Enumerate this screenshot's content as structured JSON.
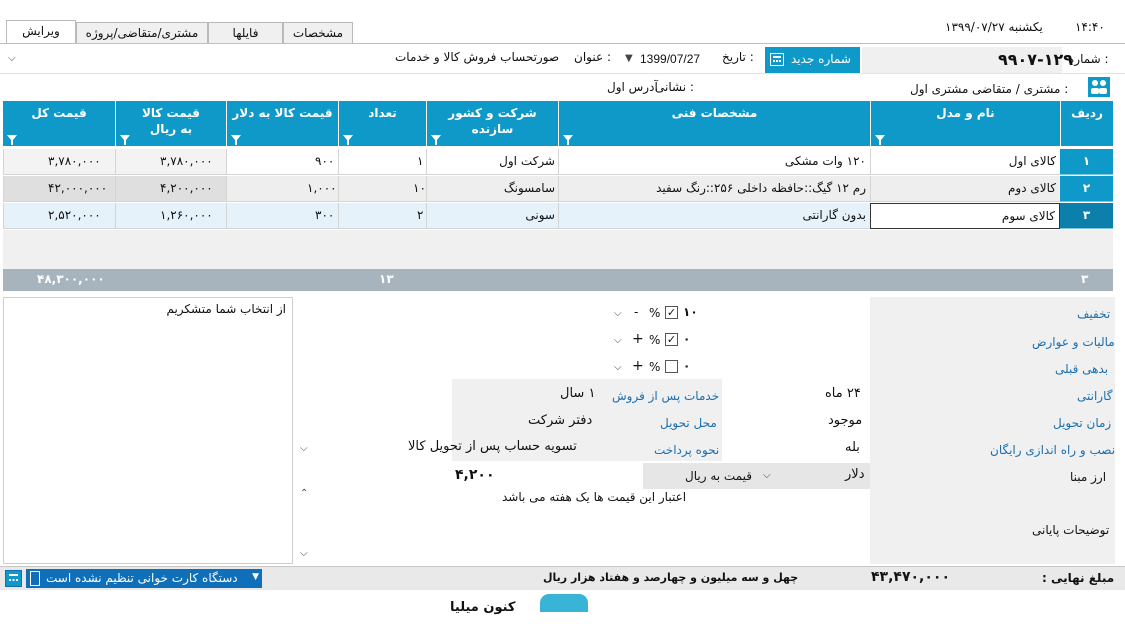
{
  "status": {
    "time": "۱۴:۴۰",
    "date": "یکشنبه  ۱۳۹۹/۰۷/۲۷"
  },
  "tabs": [
    "ویرایش",
    "مشتری/متقاضی/پروژه",
    "فایلها",
    "مشخصات"
  ],
  "header": {
    "number_label": "شماره :",
    "number_value": "۹۹۰۷-۱۲۹",
    "new_number_button": "شماره جدید",
    "date_label": "تاریخ :",
    "date_value": "1399/07/27",
    "title_label": "عنوان :",
    "title_value": "صورتحساب فروش کالا و خدمات",
    "customer_label": "مشتری / متقاضی :",
    "customer_value": "مشتری اول",
    "address_label": "نشانی :",
    "address_value": "آدرس اول"
  },
  "grid": {
    "columns": [
      "ردیف",
      "نام و مدل",
      "مشخصات فنی",
      "شرکت و کشور سازنده",
      "تعداد",
      "قیمت کالا به دلار",
      "قیمت کالا به ریال",
      "قیمت کل"
    ],
    "rows": [
      {
        "idx": "۱",
        "name": "کالای اول",
        "spec": "۱۲۰ وات مشکی",
        "maker": "شرکت اول",
        "qty": "۱",
        "usd": "۹۰۰",
        "rial": "۳,۷۸۰,۰۰۰",
        "total": "۳,۷۸۰,۰۰۰"
      },
      {
        "idx": "۲",
        "name": "کالای دوم",
        "spec": "رم ۱۲ گیگ::حافظه داخلی ۲۵۶::رنگ سفید",
        "maker": "سامسونگ",
        "qty": "۱۰",
        "usd": "۱,۰۰۰",
        "rial": "۴,۲۰۰,۰۰۰",
        "total": "۴۲,۰۰۰,۰۰۰"
      },
      {
        "idx": "۳",
        "name": "کالای سوم",
        "spec": "بدون گارانتی",
        "maker": "سونی",
        "qty": "۲",
        "usd": "۳۰۰",
        "rial": "۱,۲۶۰,۰۰۰",
        "total": "۲,۵۲۰,۰۰۰"
      }
    ],
    "footer": {
      "count": "۳",
      "qty_total": "۱۳",
      "grand_total": "۴۸,۳۰۰,۰۰۰"
    }
  },
  "details": {
    "discount_label": "تخفیف",
    "discount_value": "۱۰",
    "discount_sign": "-",
    "tax_label": "مالیات و عوارض",
    "tax_value": "۰",
    "tax_sign": "+",
    "debt_label": "بدهی قبلی",
    "debt_value": "۰",
    "debt_sign": "+",
    "percent": "%",
    "warranty_label": "گارانتی",
    "warranty_value": "۲۴ ماه",
    "after_sales_label": "خدمات پس از فروش",
    "after_sales_value": "۱ سال",
    "delivery_time_label": "زمان تحویل",
    "delivery_time_value": "موجود",
    "delivery_place_label": "محل تحویل",
    "delivery_place_value": "دفتر شرکت",
    "install_label": "نصب و راه اندازی رایگان",
    "install_value": "بله",
    "payment_label": "نحوه پرداخت",
    "payment_value": "تسویه حساب پس از تحویل کالا",
    "currency_label": "ارز مبنا",
    "currency_value": "دلار",
    "price_mode": "قیمت به ریال",
    "rate": "۴,۲۰۰",
    "notes_label": "توضیحات پایانی",
    "notes_value": "اعتبار این قیمت ها یک هفته می باشد",
    "thanks": "از انتخاب شما متشکریم"
  },
  "summary": {
    "final_label": "مبلغ نهایی :",
    "final_value": "۴۳,۴۷۰,۰۰۰",
    "final_words": "چهل و سه میلیون و چهارصد و هفتاد  هزار  ریال",
    "card_reader": "دستگاه کارت خوانی تنظیم نشده است",
    "bottom_partial": "کنون میلیا"
  },
  "colors": {
    "accent": "#0f99c8",
    "footer": "#a8b4bd",
    "label_blue": "#1a6fb0"
  }
}
